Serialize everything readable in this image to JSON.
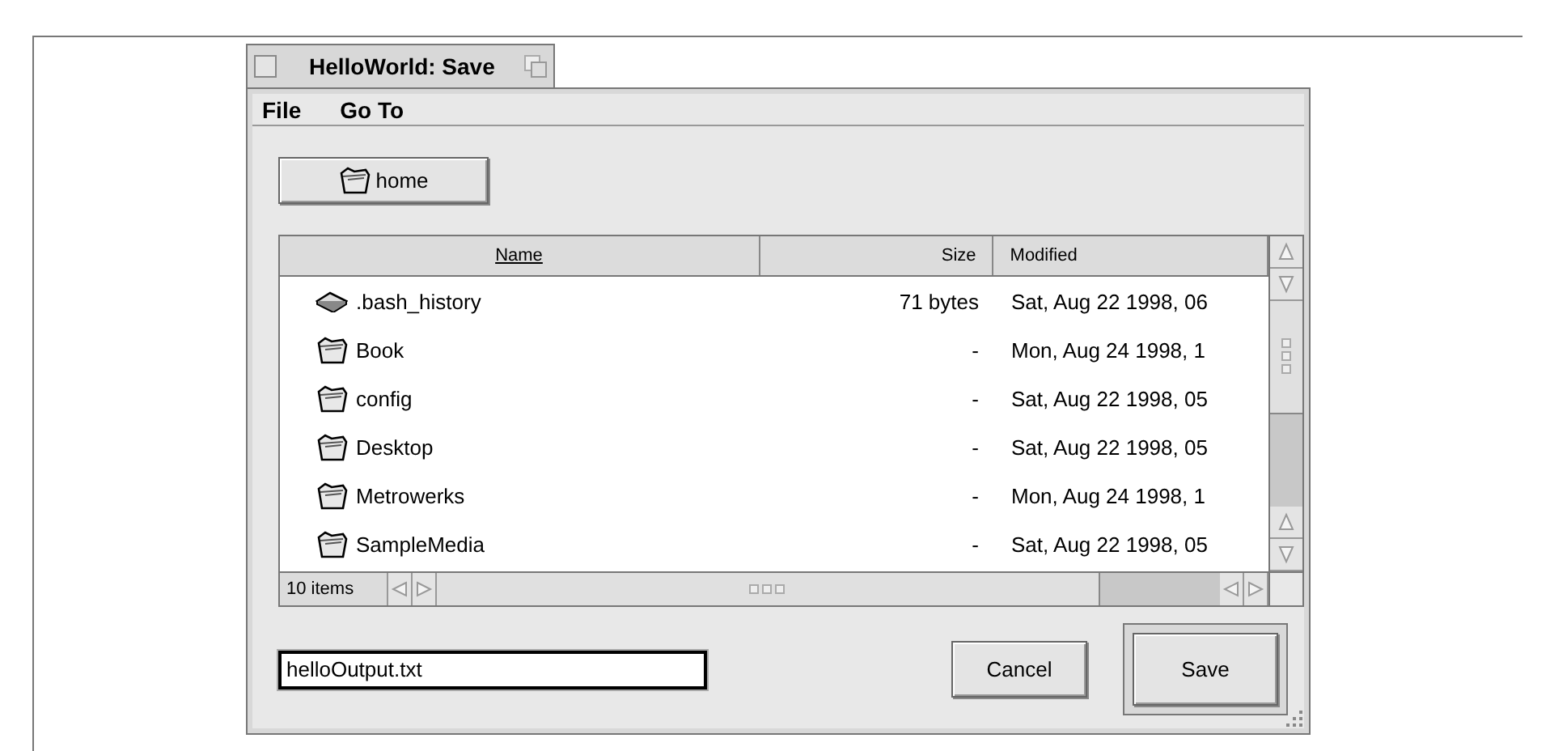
{
  "window": {
    "title": "HelloWorld: Save"
  },
  "menu": [
    "File",
    "Go To"
  ],
  "location_button": {
    "label": "home"
  },
  "table": {
    "columns": [
      {
        "label": "Name",
        "sorted": true
      },
      {
        "label": "Size",
        "sorted": false
      },
      {
        "label": "Modified",
        "sorted": false
      }
    ],
    "rows": [
      {
        "kind": "file",
        "name": ".bash_history",
        "size": "71 bytes",
        "modified": "Sat, Aug 22 1998, 06"
      },
      {
        "kind": "folder",
        "name": "Book",
        "size": "-",
        "modified": "Mon, Aug 24 1998, 1"
      },
      {
        "kind": "folder",
        "name": "config",
        "size": "-",
        "modified": "Sat, Aug 22 1998, 05"
      },
      {
        "kind": "folder",
        "name": "Desktop",
        "size": "-",
        "modified": "Sat, Aug 22 1998, 05"
      },
      {
        "kind": "folder",
        "name": "Metrowerks",
        "size": "-",
        "modified": "Mon, Aug 24 1998, 1"
      },
      {
        "kind": "folder",
        "name": "SampleMedia",
        "size": "-",
        "modified": "Sat, Aug 22 1998, 05"
      }
    ]
  },
  "status": "10 items",
  "filename": {
    "value": "helloOutput.txt"
  },
  "buttons": [
    {
      "label": "Cancel",
      "default": false
    },
    {
      "label": "Save",
      "default": true
    }
  ]
}
